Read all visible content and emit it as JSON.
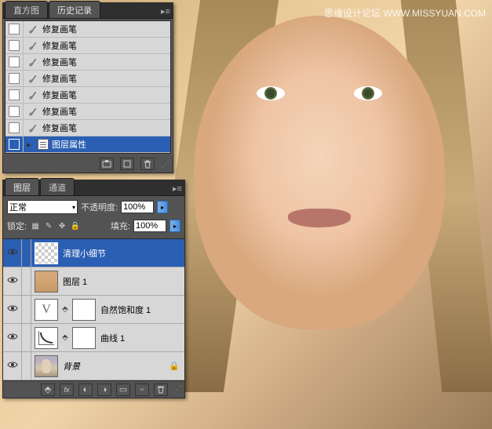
{
  "watermark": "思缘设计论坛  WWW.MISSYUAN.COM",
  "history_panel": {
    "tabs": [
      "直方图",
      "历史记录"
    ],
    "active_tab": 1,
    "items": [
      {
        "label": "修复画笔",
        "type": "brush"
      },
      {
        "label": "修复画笔",
        "type": "brush"
      },
      {
        "label": "修复画笔",
        "type": "brush"
      },
      {
        "label": "修复画笔",
        "type": "brush"
      },
      {
        "label": "修复画笔",
        "type": "brush"
      },
      {
        "label": "修复画笔",
        "type": "brush"
      },
      {
        "label": "修复画笔",
        "type": "brush"
      },
      {
        "label": "图层属性",
        "type": "doc",
        "selected": true
      }
    ]
  },
  "layers_panel": {
    "tabs": [
      "图层",
      "通道"
    ],
    "active_tab": 0,
    "blend_mode": "正常",
    "opacity_label": "不透明度:",
    "opacity_value": "100%",
    "lock_label": "锁定:",
    "fill_label": "填充:",
    "fill_value": "100%",
    "layers": [
      {
        "name": "清理小细节",
        "thumb": "checker",
        "selected": true
      },
      {
        "name": "图层 1",
        "thumb": "face"
      },
      {
        "name": "自然饱和度 1",
        "thumb": "v",
        "mask": true
      },
      {
        "name": "曲线 1",
        "thumb": "curve",
        "mask": true
      },
      {
        "name": "背景",
        "thumb": "bg",
        "locked": true,
        "italic": true
      }
    ]
  }
}
